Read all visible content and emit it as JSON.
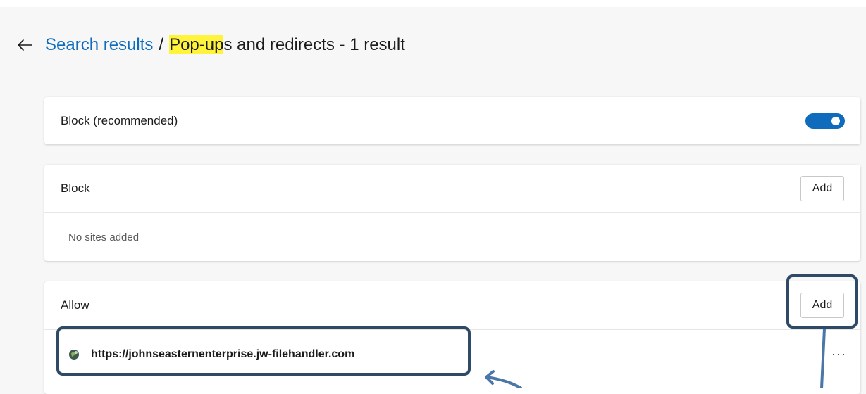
{
  "header": {
    "back_icon": "arrow-left-icon",
    "breadcrumb_link": "Search results",
    "separator": "/",
    "title_highlight": "Pop-up",
    "title_rest": "s and redirects - 1 result"
  },
  "block_recommended": {
    "label": "Block (recommended)",
    "toggle_on": true
  },
  "block": {
    "label": "Block",
    "add_label": "Add",
    "empty_text": "No sites added"
  },
  "allow": {
    "label": "Allow",
    "add_label": "Add",
    "sites": [
      {
        "url": "https://johnseasternenterprise.jw-filehandler.com",
        "more_label": "···"
      }
    ]
  },
  "colors": {
    "accent": "#0f6cbd",
    "highlight": "#fff33b",
    "annotation": "#2e4a67"
  }
}
